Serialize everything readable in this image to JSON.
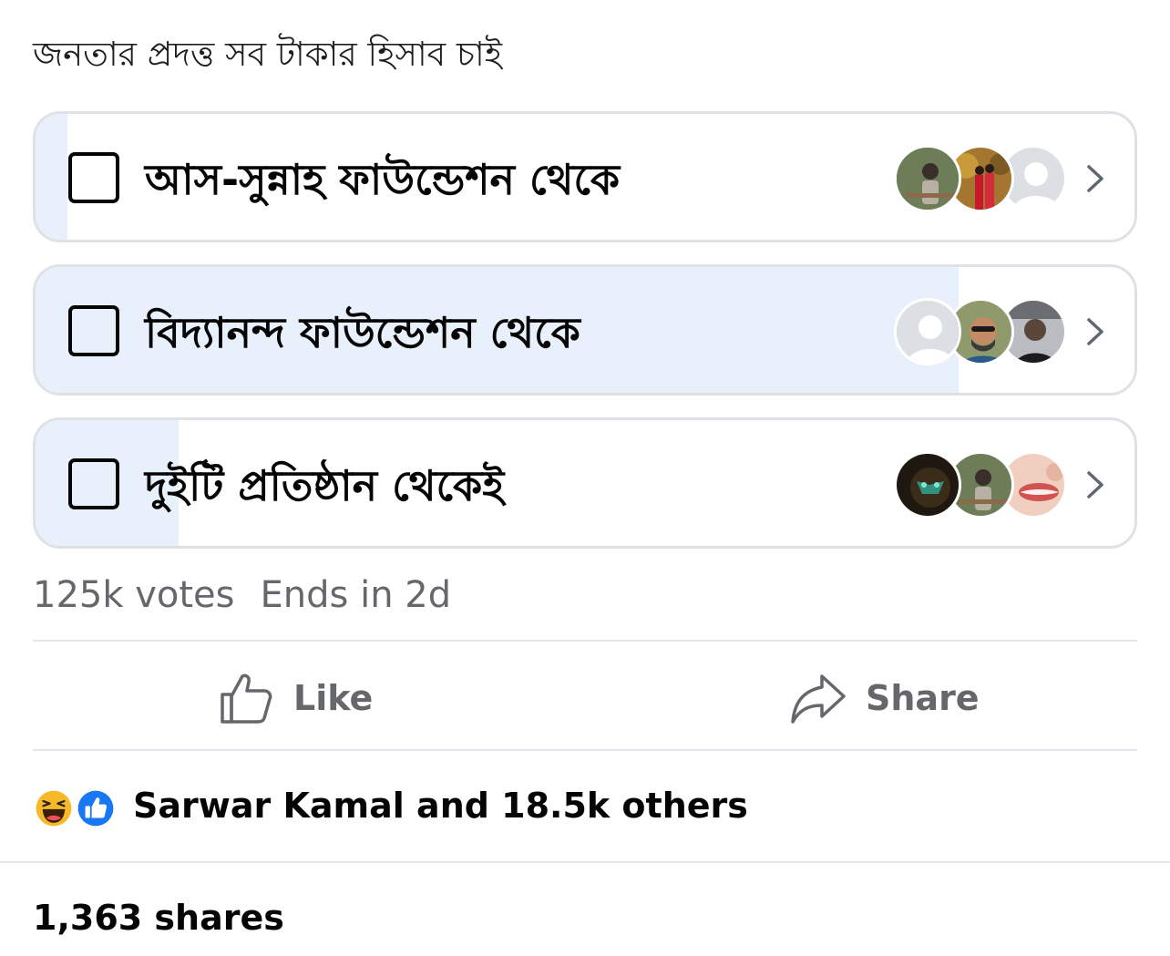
{
  "poll": {
    "question": "জনতার প্রদত্ত সব টাকার হিসাব চাই",
    "options": [
      {
        "label": "আস-সুন্নাহ ফাউন্ডেশন থেকে",
        "fill_fraction": 0.029,
        "avatars": [
          "user-photo-avatar",
          "couple-photo-avatar",
          "default-profile-avatar"
        ]
      },
      {
        "label": "বিদ্যানন্দ ফাউন্ডেশন থেকে",
        "fill_fraction": 0.84,
        "avatars": [
          "default-profile-avatar",
          "user-photo-avatar",
          "user-photo-avatar"
        ]
      },
      {
        "label": "দুইটি প্রতিষ্ঠান থেকেই",
        "fill_fraction": 0.13,
        "avatars": [
          "dark-photo-avatar",
          "user-photo-avatar",
          "user-photo-avatar"
        ]
      }
    ],
    "votes": "125k votes",
    "ends": "Ends in 2d"
  },
  "actions": {
    "like_label": "Like",
    "share_label": "Share"
  },
  "reactions": {
    "icons": [
      "haha-reaction-icon",
      "like-reaction-icon"
    ],
    "summary": "Sarwar Kamal and 18.5k others"
  },
  "shares": "1,363 shares",
  "colors": {
    "fill": "#e8f0fc",
    "border": "#dfe1e5",
    "secondary_text": "#65676b",
    "like_blue": "#1877f2",
    "haha_yellow": "#f7b928"
  }
}
